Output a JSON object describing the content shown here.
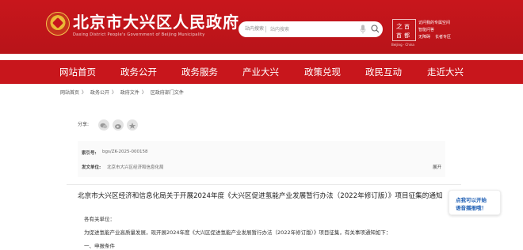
{
  "header": {
    "title": "北京市大兴区人民政府",
    "subtitle": "Daxing District People's Government of Beijing Municipality",
    "logo_caption": "Beijing · China",
    "right_links": [
      "访问我的专属空间",
      "智能问答",
      "无障碍",
      "长者专区"
    ]
  },
  "search": {
    "scope": "站内搜索",
    "placeholder": "站内搜索"
  },
  "nav": {
    "items": [
      "网站首页",
      "政务公开",
      "政务服务",
      "产业大兴",
      "政策兑现",
      "政民互动",
      "走近大兴"
    ]
  },
  "breadcrumb": [
    "网站首页",
    "政务公开",
    "政府文件",
    "区政府部门文件"
  ],
  "share": {
    "label": "分享:"
  },
  "meta": {
    "index_label": "索引号:",
    "index_value": "bgs/ZK-2025-000158",
    "issuer_label": "发文单位:",
    "issuer_value": "北京市大兴区经济和信息化局",
    "open_label": "展开"
  },
  "document": {
    "title": "北京市大兴区经济和信息化局关于开展2024年度《大兴区促进氢能产业发展暂行办法（2022年修订版）》项目征集的通知",
    "salutation": "各有关单位：",
    "paragraph": "为促进氢能产业高质量发展，现开展2024年度《大兴区促进氢能产业发展暂行办法（2022年修订版）》项目征集，有关事项通知如下：",
    "section1": "一、申报条件"
  },
  "voice_badge": {
    "line1": "点我可以开始",
    "line2": "语音播报哦！"
  },
  "colors": {
    "brand_red": "#c8161c",
    "voice_blue": "#1f5fb4"
  }
}
